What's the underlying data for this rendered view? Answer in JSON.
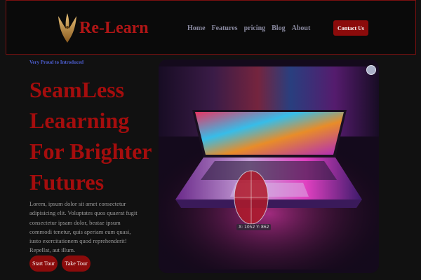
{
  "header": {
    "brand": "Re-Learn",
    "logo_icon": "phoenix-wings-icon",
    "nav": [
      "Home",
      "Features",
      "pricing",
      "Blog",
      "About"
    ],
    "contact_label": "Contact Us"
  },
  "hero": {
    "eyebrow": "Very Proud to Introduced",
    "title_lines": [
      "SeamLess",
      "Leaarning",
      "For Brighter",
      "Futures"
    ],
    "body": "Lorem, ipsum dolor sit amet consectetur adipisicing elit. Voluptates quos quaerat fugit consectetur ipsam dolor, beatae ipsum commodi tenetur, quis aperiam eum quasi, iusto exercitationem quod reprehenderit! Repellat, aut illum.",
    "start_label": "Start Tour",
    "take_label": "Take Tour",
    "image_icon": "laptop-image",
    "pause_icon": "media-control-icon",
    "coord_readout": "X: 1052 Y: 862"
  },
  "colors": {
    "accent": "#8b0b0b",
    "title": "#a50d0d",
    "eyebrow": "#4d5ed0",
    "background": "#111111"
  }
}
